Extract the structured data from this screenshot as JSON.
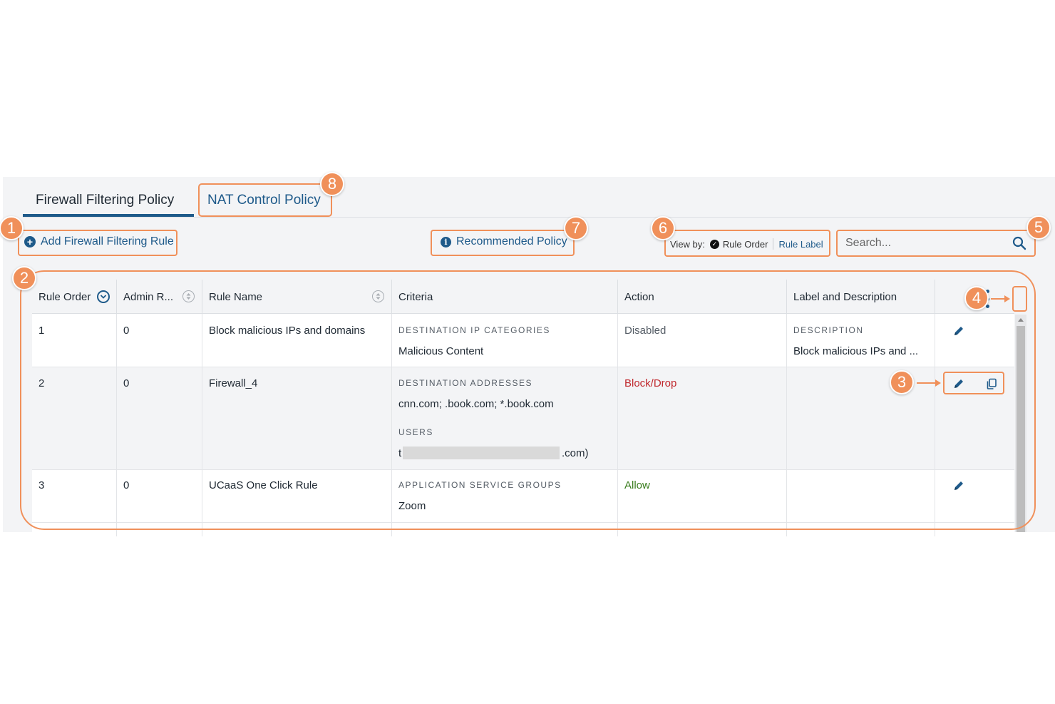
{
  "tabs": [
    {
      "label": "Firewall Filtering Policy",
      "active": true
    },
    {
      "label": "NAT Control Policy",
      "active": false
    }
  ],
  "toolbar": {
    "add_rule_label": "Add Firewall Filtering Rule",
    "recommended_label": "Recommended Policy",
    "view_by_label": "View by:",
    "view_by_options": [
      "Rule Order",
      "Rule Label"
    ],
    "view_by_selected": "Rule Order",
    "search_placeholder": "Search..."
  },
  "table": {
    "columns": [
      "Rule Order",
      "Admin R...",
      "Rule Name",
      "Criteria",
      "Action",
      "Label and Description"
    ],
    "rows": [
      {
        "order": "1",
        "admin": "0",
        "name": "Block malicious IPs and domains",
        "criteria_label": "DESTINATION IP CATEGORIES",
        "criteria_value": "Malicious Content",
        "action": "Disabled",
        "desc_label": "DESCRIPTION",
        "desc_value": "Block malicious IPs and ..."
      },
      {
        "order": "2",
        "admin": "0",
        "name": "Firewall_4",
        "criteria_label": "DESTINATION ADDRESSES",
        "criteria_value": "cnn.com; .book.com; *.book.com",
        "criteria_label_2": "USERS",
        "criteria_value_2_prefix": "t",
        "criteria_value_2_suffix": ".com)",
        "action": "Block/Drop"
      },
      {
        "order": "3",
        "admin": "0",
        "name": "UCaaS One Click Rule",
        "criteria_label": "APPLICATION SERVICE GROUPS",
        "criteria_value": "Zoom",
        "action": "Allow"
      }
    ]
  },
  "annotations": [
    "1",
    "2",
    "3",
    "4",
    "5",
    "6",
    "7",
    "8"
  ],
  "colors": {
    "accent": "#1e5a8a",
    "annotation": "#f0905a",
    "action_block": "#c0282d",
    "action_allow": "#3a7d1e",
    "action_disabled": "#555d66"
  },
  "icons": [
    "plus-circle-icon",
    "info-icon",
    "check-circle-icon",
    "search-icon",
    "sort-icon",
    "kebab-menu-icon",
    "pencil-icon",
    "copy-icon"
  ]
}
